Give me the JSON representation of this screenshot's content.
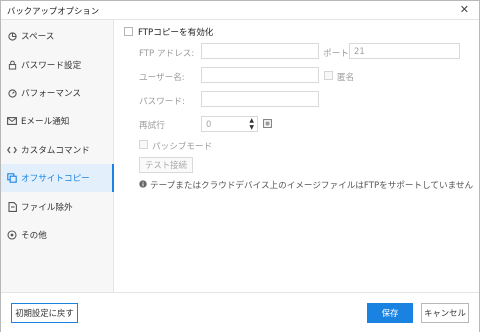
{
  "window": {
    "title": "バックアップオプション",
    "close_glyph": "✕"
  },
  "sidebar": {
    "items": [
      {
        "label": "スペース",
        "icon": "pie-icon"
      },
      {
        "label": "パスワード設定",
        "icon": "lock-icon"
      },
      {
        "label": "パフォーマンス",
        "icon": "gauge-icon"
      },
      {
        "label": "Eメール通知",
        "icon": "mail-icon"
      },
      {
        "label": "カスタムコマンド",
        "icon": "code-icon"
      },
      {
        "label": "オフサイトコピー",
        "icon": "copy-icon",
        "active": true
      },
      {
        "label": "ファイル除外",
        "icon": "file-exclude-icon"
      },
      {
        "label": "その他",
        "icon": "other-icon"
      }
    ]
  },
  "ftp": {
    "enable_label": "FTPコピーを有効化",
    "address_label": "FTP アドレス:",
    "address_value": "",
    "port_label": "ポート:",
    "port_value": "21",
    "username_label": "ユーザー名:",
    "username_value": "",
    "anonymous_label": "匿名",
    "password_label": "パスワード:",
    "password_value": "",
    "retry_label": "再試行",
    "retry_value": "0",
    "passive_label": "パッシブモード",
    "test_button": "テスト接続",
    "info_text": "テープまたはクラウドデバイス上のイメージファイルはFTPをサポートしていません"
  },
  "footer": {
    "reset_label": "初期設定に戻す",
    "save_label": "保存",
    "cancel_label": "キャンセル"
  },
  "colors": {
    "accent": "#1a82e0",
    "sidebar_active_bg": "#e3f0fb"
  }
}
